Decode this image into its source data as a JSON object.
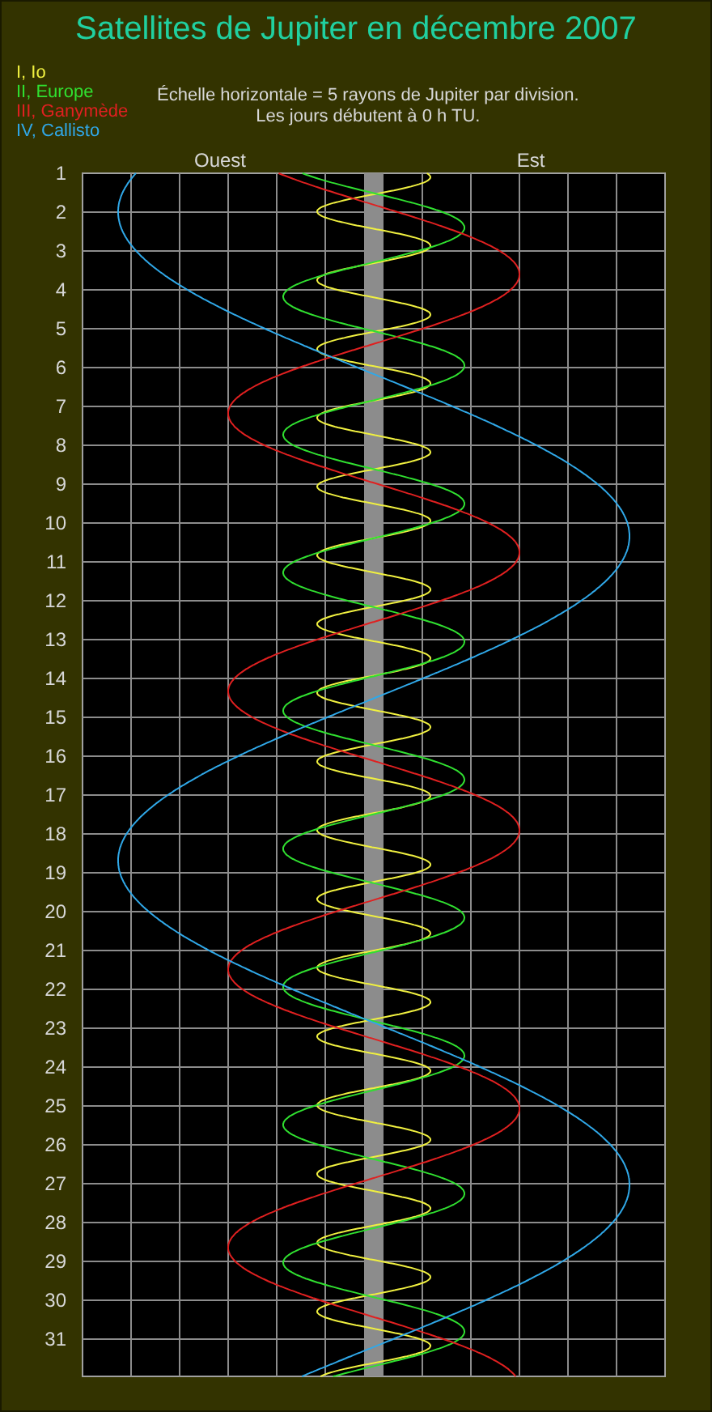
{
  "title": "Satellites de Jupiter en décembre 2007",
  "legend": [
    {
      "label": "I, Io",
      "color": "#f0f040"
    },
    {
      "label": "II, Europe",
      "color": "#30e030"
    },
    {
      "label": "III, Ganymède",
      "color": "#e02020"
    },
    {
      "label": "IV, Callisto",
      "color": "#30a8e8"
    }
  ],
  "notes": [
    "Échelle horizontale = 5 rayons de Jupiter par division.",
    "Les jours débutent à 0 h TU."
  ],
  "axis": {
    "left": "Ouest",
    "right": "Est"
  },
  "days": [
    "1",
    "2",
    "3",
    "4",
    "5",
    "6",
    "7",
    "8",
    "9",
    "10",
    "11",
    "12",
    "13",
    "14",
    "15",
    "16",
    "17",
    "18",
    "19",
    "20",
    "21",
    "22",
    "23",
    "24",
    "25",
    "26",
    "27",
    "28",
    "29",
    "30",
    "31"
  ]
}
